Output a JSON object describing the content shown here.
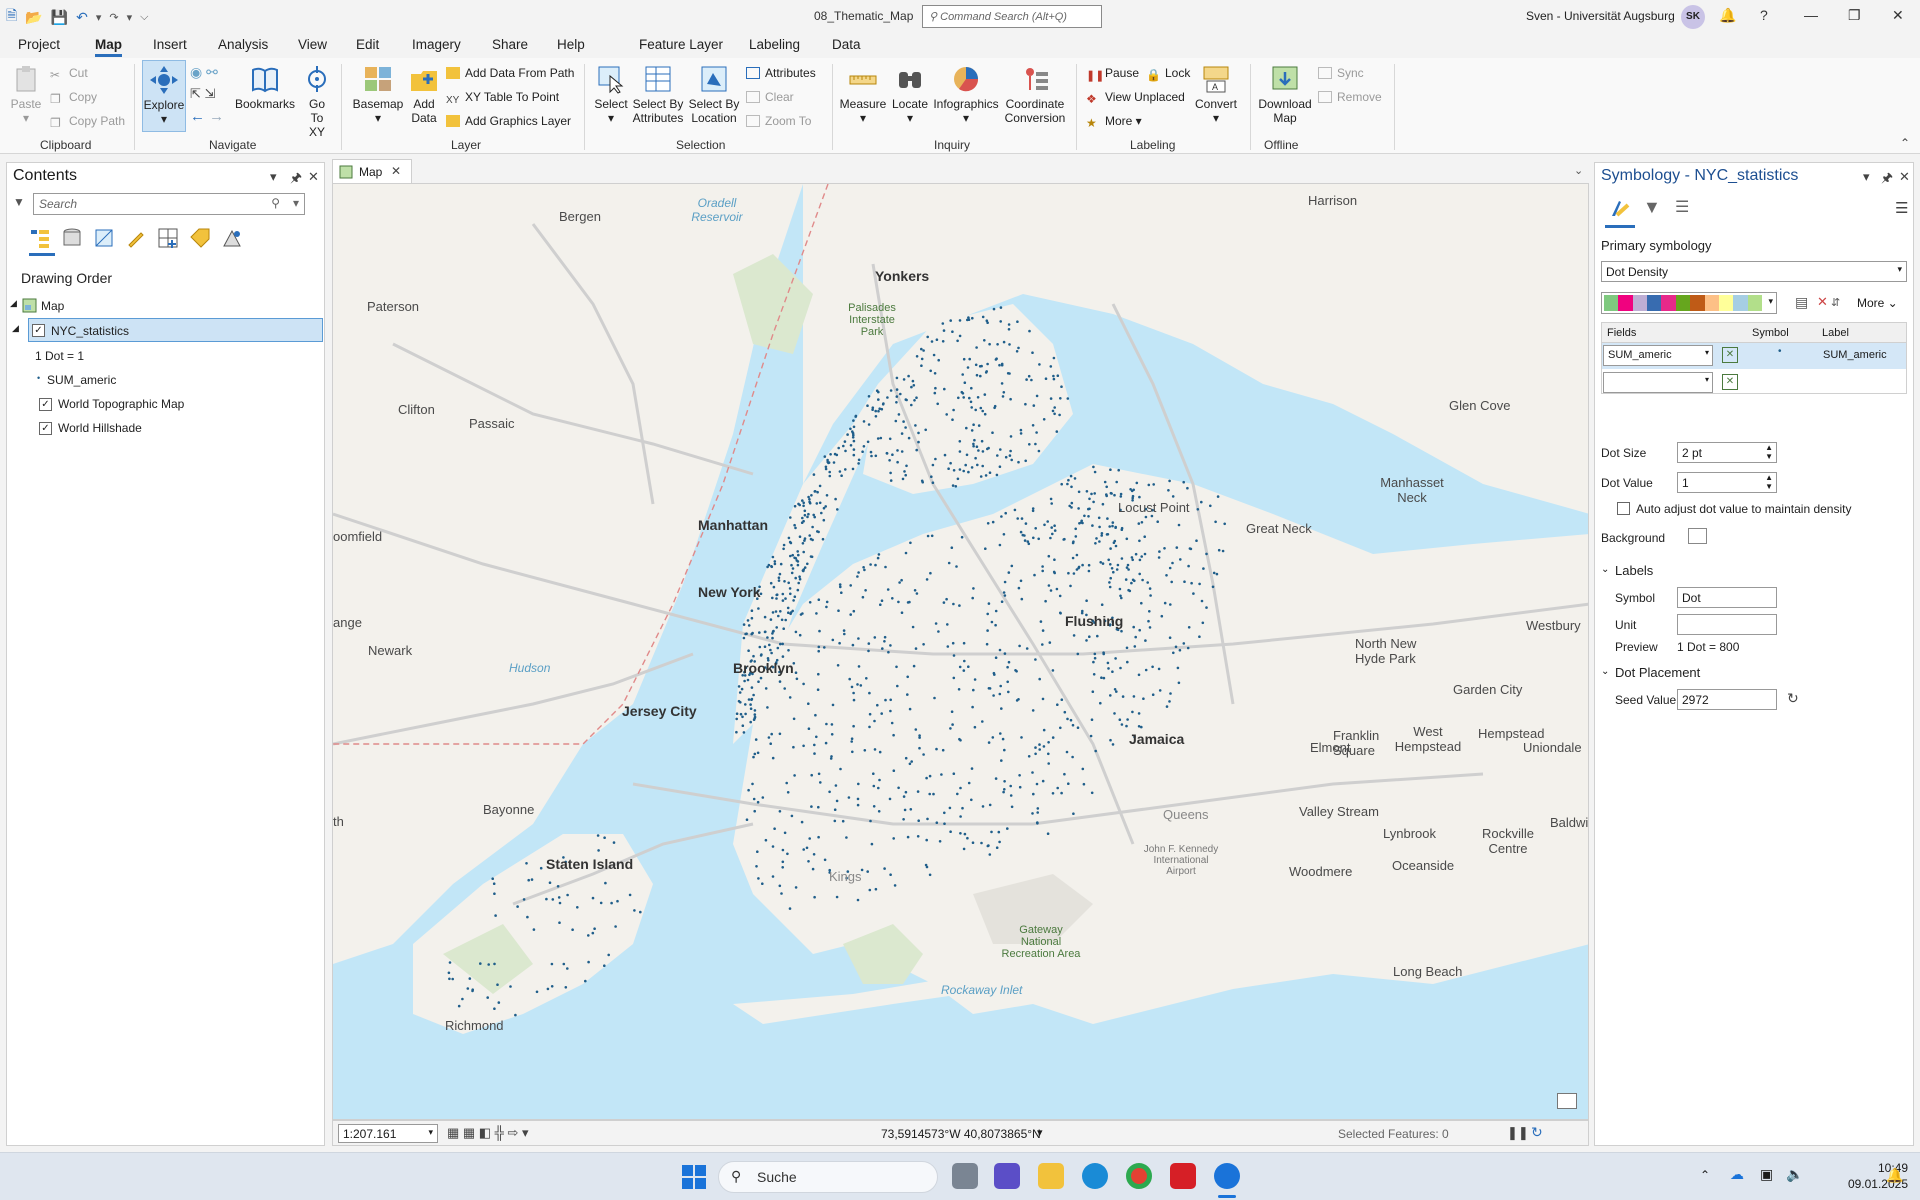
{
  "window": {
    "doc_title": "08_Thematic_Map",
    "command_search_placeholder": "Command Search (Alt+Q)",
    "user": "Sven - Universität Augsburg",
    "avatar_initials": "SK"
  },
  "tabs": [
    "Project",
    "Map",
    "Insert",
    "Analysis",
    "View",
    "Edit",
    "Imagery",
    "Share",
    "Help"
  ],
  "context_tabs": [
    "Feature Layer",
    "Labeling",
    "Data"
  ],
  "ribbon": {
    "clipboard": {
      "label": "Clipboard",
      "paste": "Paste",
      "cut": "Cut",
      "copy": "Copy",
      "copy_path": "Copy Path"
    },
    "navigate": {
      "label": "Navigate",
      "explore": "Explore",
      "bookmarks": "Bookmarks",
      "go_to_xy": "Go To XY"
    },
    "layer": {
      "label": "Layer",
      "basemap": "Basemap",
      "add_data": "Add Data",
      "add_data_from_path": "Add Data From Path",
      "xy_table": "XY Table To Point",
      "add_graphics": "Add Graphics Layer"
    },
    "selection": {
      "label": "Selection",
      "select": "Select",
      "select_by_attributes": "Select By Attributes",
      "select_by_location": "Select By Location",
      "attributes": "Attributes",
      "clear": "Clear",
      "zoom_to": "Zoom To"
    },
    "inquiry": {
      "label": "Inquiry",
      "measure": "Measure",
      "locate": "Locate",
      "infographics": "Infographics",
      "coordinate_conversion": "Coordinate Conversion"
    },
    "labeling": {
      "label": "Labeling",
      "pause": "Pause",
      "lock": "Lock",
      "view_unplaced": "View Unplaced",
      "more": "More",
      "convert": "Convert"
    },
    "offline": {
      "label": "Offline",
      "download_map": "Download Map",
      "sync": "Sync",
      "remove": "Remove"
    }
  },
  "contents": {
    "title": "Contents",
    "search_placeholder": "Search",
    "drawing_order": "Drawing Order",
    "map_item": "Map",
    "layers": [
      {
        "name": "NYC_statistics",
        "checked": true,
        "selected": true
      },
      {
        "name": "World Topographic Map",
        "checked": true
      },
      {
        "name": "World Hillshade",
        "checked": true
      }
    ],
    "legend_dot": "1 Dot = 1",
    "legend_field": "SUM_americ"
  },
  "map": {
    "tab_label": "Map",
    "scale": "1:207.161",
    "coordinates": "73,5914573°W 40,8073865°N",
    "selected_features": "Selected Features: 0",
    "labels": {
      "manhattan": "Manhattan",
      "new_york": "New York",
      "brooklyn": "Brooklyn",
      "jersey_city": "Jersey City",
      "newark": "Newark",
      "bayonne": "Bayonne",
      "staten_island": "Staten Island",
      "yonkers": "Yonkers",
      "paterson": "Paterson",
      "clifton": "Clifton",
      "passaic": "Passaic",
      "flushing": "Flushing",
      "jamaica": "Jamaica",
      "great_neck": "Great Neck",
      "glen_cove": "Glen Cove",
      "manhasset_neck": "Manhasset Neck",
      "locust_point": "Locust Point",
      "harrison": "Harrison",
      "bergen": "Bergen",
      "westbury": "Westbury",
      "garden_city": "Garden City",
      "elmont": "Elmont",
      "valley_stream": "Valley Stream",
      "lynbrook": "Lynbrook",
      "woodmere": "Woodmere",
      "oceanside": "Oceanside",
      "baldwin": "Baldwin",
      "long_beach": "Long Beach",
      "richmond": "Richmond",
      "hudson": "Hudson",
      "kings": "Kings",
      "queens": "Queens",
      "new_hyde_park": "North New Hyde Park",
      "franklin_square": "Franklin Square",
      "west_hempstead": "West Hempstead",
      "hempstead": "Hempstead",
      "uniondale": "Uniondale",
      "rockville_centre": "Rockville Centre",
      "rockaway_inlet": "Rockaway Inlet",
      "gateway": "Gateway National Recreation Area",
      "jfk": "John F. Kennedy International Airport",
      "palisades": "Palisades Interstate Park",
      "oradell": "Oradell Reservoir",
      "bloomfield": "oomfield",
      "orange": "ange",
      "linden": "th"
    }
  },
  "symbology": {
    "title": "Symbology - NYC_statistics",
    "primary": "Primary symbology",
    "method": "Dot Density",
    "more": "More",
    "col_fields": "Fields",
    "col_symbol": "Symbol",
    "col_label": "Label",
    "field_value": "SUM_americ",
    "field_label": "SUM_americ",
    "dot_size_label": "Dot Size",
    "dot_size": "2 pt",
    "dot_value_label": "Dot Value",
    "dot_value": "1",
    "auto_adjust": "Auto adjust dot value to maintain density",
    "background": "Background",
    "labels_section": "Labels",
    "symbol_label": "Symbol",
    "symbol_value": "Dot",
    "unit_label": "Unit",
    "preview_label": "Preview",
    "preview_value": "1 Dot = 800",
    "placement_section": "Dot Placement",
    "seed_label": "Seed Value",
    "seed_value": "2972",
    "palette": [
      "#7fc97f",
      "#f0027f",
      "#beaed4",
      "#386cb0",
      "#e7298a",
      "#66a61e",
      "#bf5b17",
      "#fdc086",
      "#ffff99",
      "#a6cee3",
      "#b2df8a"
    ]
  },
  "taskbar": {
    "search": "Suche",
    "time": "10:49",
    "date": "09.01.2025"
  },
  "colors": {
    "accent": "#2a6ebb",
    "dots": "#1f5e8a",
    "water": "#c2e6f7",
    "land": "#f4f2ee"
  }
}
